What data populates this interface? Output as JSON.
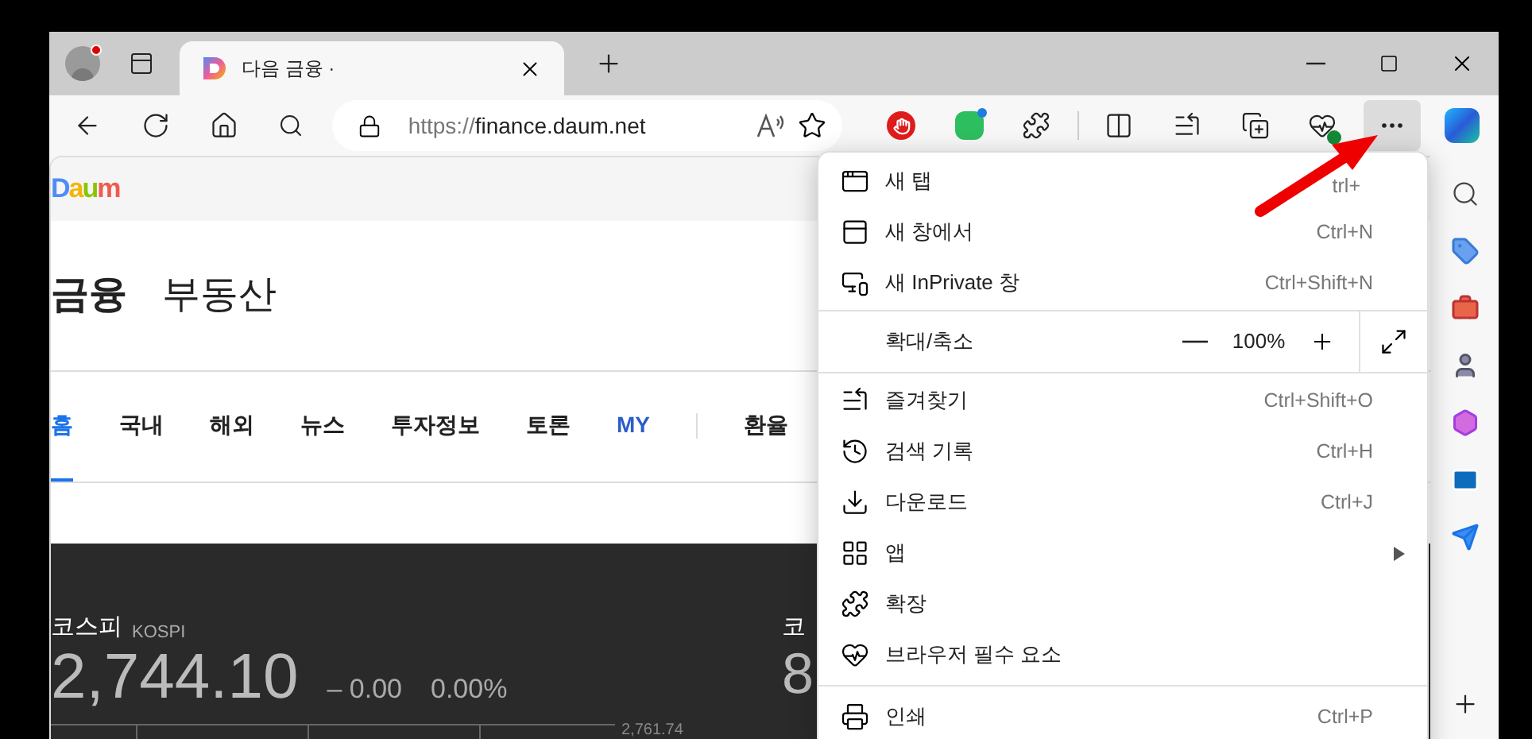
{
  "window": {
    "tab_title": "다음 금융 ·",
    "url_scheme": "https://",
    "url_host": "finance.daum.net"
  },
  "page": {
    "logo": "Daum",
    "sections": [
      {
        "label": "금융",
        "selected": true
      },
      {
        "label": "부동산",
        "selected": false
      }
    ],
    "nav": [
      {
        "label": "홈",
        "kind": "section",
        "selected": true
      },
      {
        "label": "국내",
        "kind": "section",
        "selected": false
      },
      {
        "label": "해외",
        "kind": "section",
        "selected": false
      },
      {
        "label": "뉴스",
        "kind": "section",
        "selected": false
      },
      {
        "label": "투자정보",
        "kind": "section",
        "selected": false
      },
      {
        "label": "토론",
        "kind": "section",
        "selected": false
      },
      {
        "label": "MY",
        "kind": "my",
        "selected": false
      },
      {
        "label": "환율",
        "kind": "extra",
        "selected": false
      }
    ],
    "index": {
      "name": "코스피",
      "code": "KOSPI",
      "value": "2,744.10",
      "sign": "–",
      "change": "0.00",
      "rate": "0.00%",
      "chart_label": "2,761.74"
    },
    "index_2": {
      "name": "코",
      "value": "8"
    }
  },
  "menu": [
    {
      "kind": "item",
      "label": "새 탭",
      "shortcut": "trl+",
      "submenu": false
    },
    {
      "kind": "item",
      "label": "새 창에서",
      "shortcut": "Ctrl+N",
      "submenu": false
    },
    {
      "kind": "item",
      "label": "새 InPrivate 창",
      "shortcut": "Ctrl+Shift+N",
      "submenu": false
    },
    {
      "kind": "zoom",
      "label": "확대/축소",
      "value": "100%"
    },
    {
      "kind": "item",
      "label": "즐겨찾기",
      "shortcut": "Ctrl+Shift+O",
      "submenu": false
    },
    {
      "kind": "item",
      "label": "검색 기록",
      "shortcut": "Ctrl+H",
      "submenu": false
    },
    {
      "kind": "item",
      "label": "다운로드",
      "shortcut": "Ctrl+J",
      "submenu": false
    },
    {
      "kind": "item",
      "label": "앱",
      "submenu": true
    },
    {
      "kind": "item",
      "label": "확장",
      "submenu": false
    },
    {
      "kind": "item",
      "label": "브라우저 필수 요소",
      "submenu": false
    },
    {
      "kind": "item",
      "label": "인쇄",
      "shortcut": "Ctrl+P",
      "submenu": false
    }
  ]
}
